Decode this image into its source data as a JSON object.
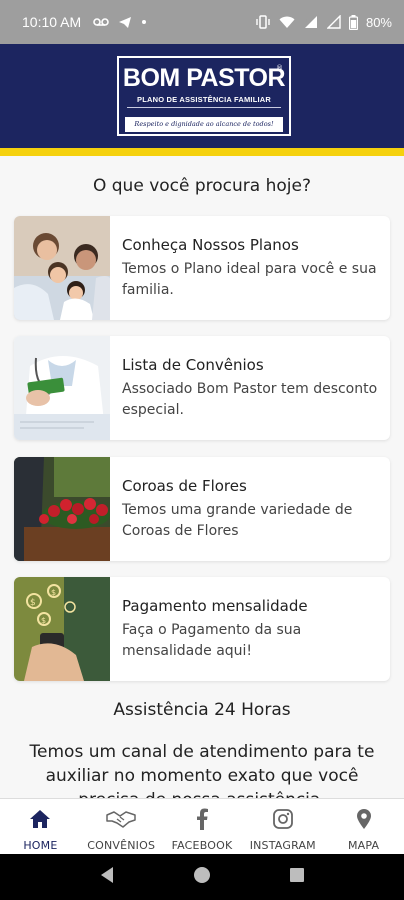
{
  "status": {
    "time": "10:10 AM",
    "battery": "80%",
    "icons": [
      "voicemail-icon",
      "telegram-icon",
      "dot-icon",
      "vibrate-icon",
      "wifi-icon",
      "lte-signal-icon",
      "signal-icon",
      "battery-icon"
    ]
  },
  "header": {
    "logo_name": "BOM PASTOR",
    "logo_reg": "®",
    "logo_sub": "PLANO DE ASSISTÊNCIA FAMILIAR",
    "logo_slogan": "Respeito e dignidade ao alcance de todos!",
    "colors": {
      "navy": "#1c2560",
      "stripe": "#f5d10e"
    }
  },
  "main": {
    "heading": "O que você procura hoje?",
    "cards": [
      {
        "title": "Conheça Nossos Planos",
        "desc": "Temos o Plano ideal para você e sua familia.",
        "image": "family-photo"
      },
      {
        "title": "Lista de Convênios",
        "desc": "Associado Bom Pastor tem desconto especial.",
        "image": "doctor-photo"
      },
      {
        "title": "Coroas de Flores",
        "desc": "Temos uma grande variedade de Coroas de Flores",
        "image": "flower-wreath-photo"
      },
      {
        "title": "Pagamento mensalidade",
        "desc": "Faça o Pagamento da sua mensalidade aqui!",
        "image": "payment-photo"
      }
    ],
    "assist_heading": "Assistência 24 Horas",
    "assist_text": "Temos um canal de atendimento para te auxiliar no momento exato que você precisa de nossa assistência."
  },
  "bottom_nav": [
    {
      "label": "HOME",
      "icon": "home-icon",
      "active": true
    },
    {
      "label": "CONVÊNIOS",
      "icon": "handshake-icon",
      "active": false
    },
    {
      "label": "FACEBOOK",
      "icon": "facebook-icon",
      "active": false
    },
    {
      "label": "INSTAGRAM",
      "icon": "instagram-icon",
      "active": false
    },
    {
      "label": "MAPA",
      "icon": "map-pin-icon",
      "active": false
    }
  ]
}
